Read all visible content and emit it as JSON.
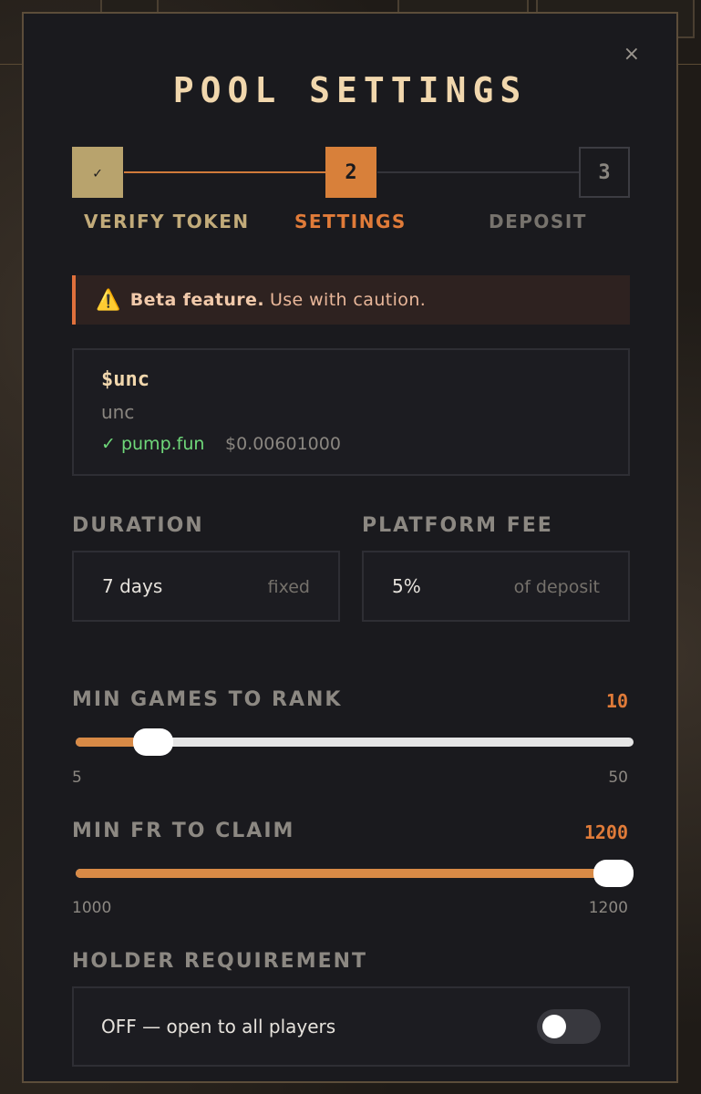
{
  "modal": {
    "title": "POOL SETTINGS",
    "close_label": "×"
  },
  "stepper": {
    "steps": [
      {
        "number": "✓",
        "label": "VERIFY TOKEN",
        "state": "done"
      },
      {
        "number": "2",
        "label": "SETTINGS",
        "state": "active"
      },
      {
        "number": "3",
        "label": "DEPOSIT",
        "state": "upcoming"
      }
    ]
  },
  "warning": {
    "icon": "⚠️",
    "bold": "Beta feature.",
    "text": "Use with caution."
  },
  "token": {
    "symbol": "$unc",
    "name": "unc",
    "platform": "✓ pump.fun",
    "price": "$0.00601000"
  },
  "duration": {
    "label": "DURATION",
    "value": "7 days",
    "suffix": "fixed"
  },
  "platform_fee": {
    "label": "PLATFORM FEE",
    "value": "5%",
    "suffix": "of deposit"
  },
  "min_games": {
    "label": "MIN GAMES TO RANK",
    "value": "10",
    "min": "5",
    "max": "50",
    "current": 10,
    "min_num": 5,
    "max_num": 50
  },
  "min_fr": {
    "label": "MIN FR TO CLAIM",
    "value": "1200",
    "min": "1000",
    "max": "1200",
    "current": 1200,
    "min_num": 1000,
    "max_num": 1200
  },
  "holder": {
    "label": "HOLDER REQUIREMENT",
    "text": "OFF — open to all players",
    "enabled": false
  },
  "colors": {
    "accent": "#e07b39",
    "done_step": "#b8a36d",
    "success": "#6fd97a",
    "title": "#f1d7ad"
  }
}
